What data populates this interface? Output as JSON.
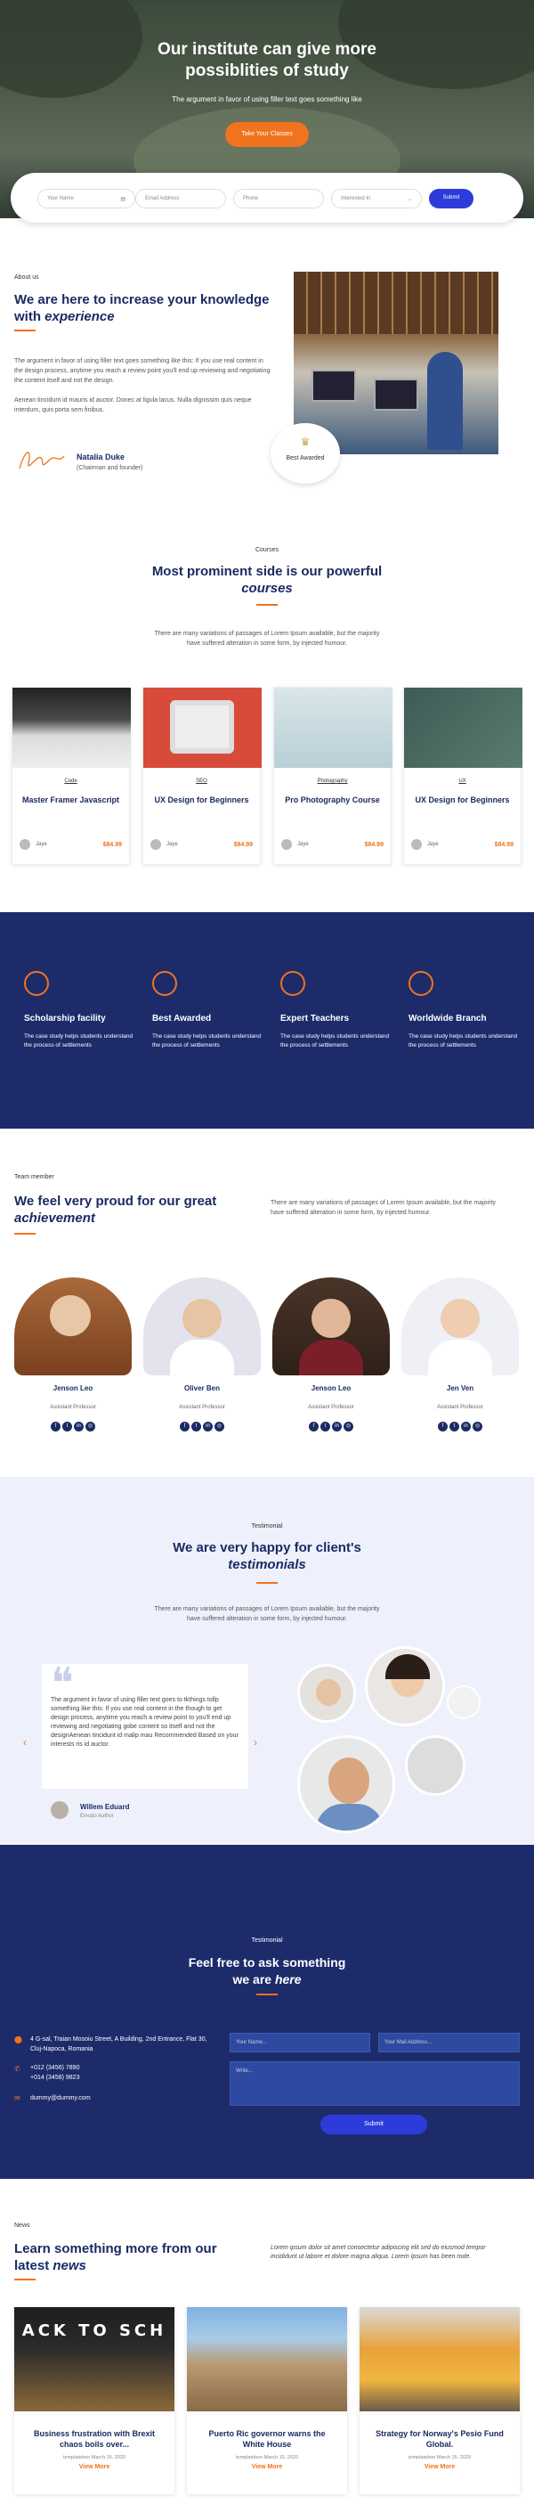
{
  "hero": {
    "title_line1": "Our institute can give more",
    "title_line2": "possiblities of study",
    "subtitle": "The argument in favor of using filler text goes something like",
    "cta": "Take Your Classes"
  },
  "search_form": {
    "name_placeholder": "Your Name",
    "email_placeholder": "Email Address",
    "phone_placeholder": "Phone",
    "interest_placeholder": "Interested In",
    "submit": "Submit"
  },
  "about": {
    "label": "About us",
    "heading": "We are here to increase your knowledge with",
    "heading_em": "experience",
    "para1": "The argument in favor of using filler text goes something like this: If you use real content in the design process, anytime you reach a review point you'll end up reviewing and negotiating the content itself and not the design.",
    "para2": "Aenean tincidunt id mauris id auctor. Donec at ligula lacus. Nulla dignissim quis neque interdum, quis porta sem finibus.",
    "signer_name": "Natalia Duke",
    "signer_role": "(Chairman and founder)",
    "badge": "Best Awarded"
  },
  "courses": {
    "label": "Courses",
    "heading": "Most prominent side is our powerful",
    "heading_em": "courses",
    "description": "There are many variations of passages of Lorem Ipsum available, but the majority have suffered alteration in some form, by injected humour.",
    "items": [
      {
        "category": "Code",
        "title": "Master Framer Javascript",
        "author": "Jaye",
        "price": "$84.99"
      },
      {
        "category": "SEO",
        "title": "UX Design for Beginners",
        "author": "Jaye",
        "price": "$84.99"
      },
      {
        "category": "Photography",
        "title": "Pro Photography Course",
        "author": "Jaye",
        "price": "$84.99"
      },
      {
        "category": "UX",
        "title": "UX Design for Beginners",
        "author": "Jaye",
        "price": "$84.99"
      }
    ]
  },
  "features": [
    {
      "title": "Scholarship facility",
      "text": "The case study helps students understand the process of settlements",
      "icon": "thumbs-up-icon"
    },
    {
      "title": "Best Awarded",
      "text": "The case study helps students understand the process of settlements",
      "icon": "award-icon"
    },
    {
      "title": "Expert Teachers",
      "text": "The case study helps students understand the process of settlements",
      "icon": "teacher-icon"
    },
    {
      "title": "Worldwide Branch",
      "text": "The case study helps students understand the process of settlements",
      "icon": "globe-icon"
    }
  ],
  "team": {
    "label": "Team member",
    "heading": "We feel very proud for our great",
    "heading_em": "achievement",
    "description": "There are many variations of passages of Lorem Ipsum available, but the majority have suffered alteration in some form, by injected humour.",
    "members": [
      {
        "name": "Jenson Leo",
        "role": "Assistant Professor"
      },
      {
        "name": "Oliver Ben",
        "role": "Assistant Professor"
      },
      {
        "name": "Jenson Leo",
        "role": "Assistant Professor"
      },
      {
        "name": "Jen Ven",
        "role": "Assistant Professor"
      }
    ]
  },
  "testimonial": {
    "label": "Testimonial",
    "heading": "We are very happy for client's",
    "heading_em": "testimonials",
    "description": "There are many variations of passages of Lorem Ipsum available, but the majority have suffered alteration in some form, by injected humour.",
    "quote": "The argument in favor of using filler text goes to tkthings tollp something like this: If you use real content in the though to get design process, anytime you reach a review point to you'll end up reviewing and negotiating gobe content so itself and not the designAenean tincidunt id malip mau Recommended Based on your interests ris id auctor.",
    "author_name": "Willem Eduard",
    "author_role": "Envato Author"
  },
  "contact": {
    "label": "Testimonial",
    "heading": "Feel free to ask something",
    "heading2": "we are",
    "heading_em": "here",
    "address": "4 G-sal, Traian Mosoiu Street, A Building, 2nd Entrance, Flat 30, Cluj-Napoca, Romania",
    "phone1": "+012 (3456) 7890",
    "phone2": "+014 (3458) 9823",
    "email": "dummy@dummy.com",
    "name_placeholder": "Your Name...",
    "email_placeholder": "Your Mail Address...",
    "message_placeholder": "Write...",
    "submit": "Submit"
  },
  "news": {
    "label": "News",
    "heading": "Learn something more from our latest",
    "heading_em": "news",
    "description": "Lorem ipsum dolor sit amet consectetur adipiscing elit sed do eiusmod tempor incididunt ut labore et dolore magna aliqua. Lorem Ipsum has been rode.",
    "items": [
      {
        "title": "Business frustration with Brexit chaos boils over...",
        "date": "templatebon March 15, 2020",
        "link": "View More"
      },
      {
        "title": "Puerto Ric governor warns the White House",
        "date": "templatebon March 15, 2020",
        "link": "View More"
      },
      {
        "title": "Strategy for Norway's Pesio Fund Global.",
        "date": "templatebon March 15, 2020",
        "link": "View More"
      }
    ]
  },
  "colors": {
    "accent": "#f0731e",
    "navy": "#1a2b63",
    "blue": "#2d3bdb"
  }
}
